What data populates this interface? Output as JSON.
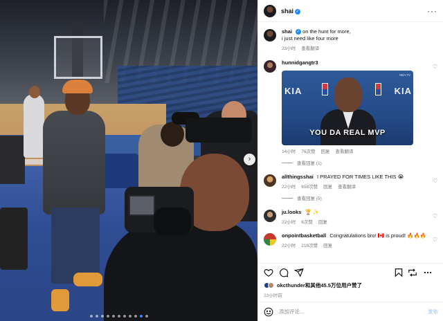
{
  "post": {
    "username": "shai",
    "caption_line1": "on the hunt for more,",
    "caption_line2": "i just need like four more",
    "caption_time": "23小时",
    "caption_translate": "查看翻译"
  },
  "carousel": {
    "next_symbol": "›",
    "dot_count": 11,
    "active_dot": 9
  },
  "comments": [
    {
      "username": "hunnidgangtr3",
      "gif_caption": "YOU DA REAL MVP",
      "gif_logo_text": "KIA",
      "gif_badge": "NBA TV",
      "time": "14小时",
      "likes": "76次赞",
      "reply": "回复",
      "translate": "查看翻译",
      "view_replies": "查看回复 (1)"
    },
    {
      "username": "allthingsshai",
      "text": "I PRAYED FOR TIMES LIKE THIS 😭",
      "time": "22小时",
      "likes": "658次赞",
      "reply": "回复",
      "translate": "查看翻译",
      "view_replies": "查看回复 (5)"
    },
    {
      "username": "ju.looks",
      "text": "🏆 ✨",
      "time": "22小时",
      "likes": "6次赞",
      "reply": "回复"
    },
    {
      "username": "onpointbasketball",
      "text": "Congratulations bro! 🇨🇦 is proud! 🔥🔥🔥",
      "time": "22小时",
      "likes": "218次赞",
      "reply": "回复"
    }
  ],
  "actions": {
    "liked_by_user": "okcthunder",
    "liked_by_rest": "和其他45.5万位用户赞了",
    "post_time": "23小时前",
    "comment_placeholder": "添加评论...",
    "post_label": "发布"
  }
}
